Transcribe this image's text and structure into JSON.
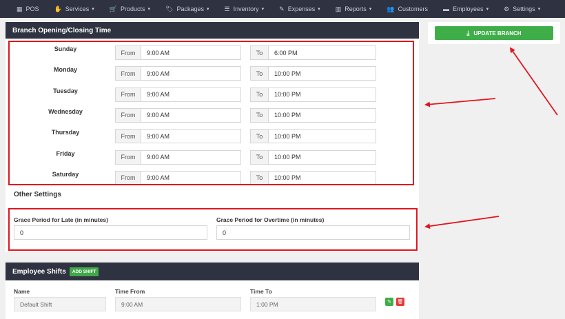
{
  "nav": {
    "items": [
      {
        "name": "pos",
        "icon": "calculator-icon",
        "glyph": "▦",
        "label": "POS",
        "caret": false
      },
      {
        "name": "services",
        "icon": "hand-icon",
        "glyph": "✋",
        "label": "Services",
        "caret": true
      },
      {
        "name": "products",
        "icon": "cart-icon",
        "glyph": "🛒",
        "label": "Products",
        "caret": true
      },
      {
        "name": "packages",
        "icon": "tag-icon",
        "glyph": "🏷",
        "label": "Packages",
        "caret": true
      },
      {
        "name": "inventory",
        "icon": "list-icon",
        "glyph": "☰",
        "label": "Inventory",
        "caret": true
      },
      {
        "name": "expenses",
        "icon": "expense-icon",
        "glyph": "✎",
        "label": "Expenses",
        "caret": true
      },
      {
        "name": "reports",
        "icon": "chart-icon",
        "glyph": "▥",
        "label": "Reports",
        "caret": true
      },
      {
        "name": "customers",
        "icon": "users-icon",
        "glyph": "👥",
        "label": "Customers",
        "caret": false
      },
      {
        "name": "employees",
        "icon": "briefcase-icon",
        "glyph": "▬",
        "label": "Employees",
        "caret": true
      },
      {
        "name": "settings",
        "icon": "gear-icon",
        "glyph": "⚙",
        "label": "Settings",
        "caret": true
      }
    ]
  },
  "branch_hours": {
    "title": "Branch Opening/Closing Time",
    "from_label": "From",
    "to_label": "To",
    "days": [
      {
        "day": "Sunday",
        "from": "9:00 AM",
        "to": "6:00 PM"
      },
      {
        "day": "Monday",
        "from": "9:00 AM",
        "to": "10:00 PM"
      },
      {
        "day": "Tuesday",
        "from": "9:00 AM",
        "to": "10:00 PM"
      },
      {
        "day": "Wednesday",
        "from": "9:00 AM",
        "to": "10:00 PM"
      },
      {
        "day": "Thursday",
        "from": "9:00 AM",
        "to": "10:00 PM"
      },
      {
        "day": "Friday",
        "from": "9:00 AM",
        "to": "10:00 PM"
      },
      {
        "day": "Saturday",
        "from": "9:00 AM",
        "to": "10:00 PM"
      }
    ]
  },
  "other_settings": {
    "title": "Other Settings",
    "grace_late_label": "Grace Period for Late (in minutes)",
    "grace_late_value": "0",
    "grace_overtime_label": "Grace Period for Overtime (in minutes)",
    "grace_overtime_value": "0"
  },
  "shifts": {
    "title": "Employee Shifts",
    "add_button": "ADD SHIFT",
    "col_name": "Name",
    "col_from": "Time From",
    "col_to": "Time To",
    "rows": [
      {
        "name": "Default Shift",
        "from": "9:00 AM",
        "to": "1:00 PM"
      }
    ]
  },
  "update_button": "UPDATE BRANCH",
  "colors": {
    "nav_bg": "#2f3240",
    "accent_green": "#3fae49",
    "annotation_red": "#e0151f",
    "delete_red": "#e53935"
  }
}
